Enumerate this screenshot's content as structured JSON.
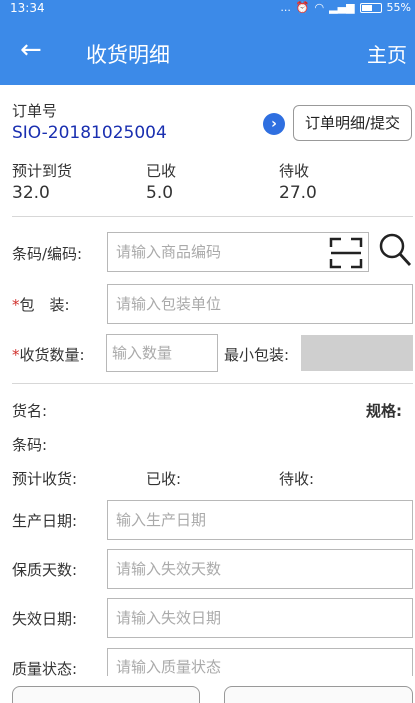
{
  "status": {
    "time": "13:34",
    "dots": "...",
    "battery": "55%"
  },
  "appbar": {
    "back": "←",
    "title": "收货明细",
    "home": "主页"
  },
  "order": {
    "label": "订单号",
    "number": "SIO-20181025004",
    "detail_button": "订单明细/提交"
  },
  "summary": {
    "expected_label": "预计到货",
    "expected_value": "32.0",
    "received_label": "已收",
    "received_value": "5.0",
    "pending_label": "待收",
    "pending_value": "27.0"
  },
  "form": {
    "barcode_label": "条码/编码:",
    "barcode_placeholder": "请输入商品编码",
    "package_star": "*",
    "package_label": "包　装:",
    "package_placeholder": "请输入包装单位",
    "qty_star": "*",
    "qty_label": "收货数量:",
    "qty_placeholder": "输入数量",
    "min_pack_label": "最小包装:"
  },
  "goods": {
    "name_label": "货名:",
    "spec_label": "规格:",
    "barcode_label": "条码:",
    "expected_label": "预计收货:",
    "received_label": "已收:",
    "pending_label": "待收:"
  },
  "dates": {
    "production_label": "生产日期:",
    "production_placeholder": "输入生产日期",
    "shelf_label": "保质天数:",
    "shelf_placeholder": "请输入失效天数",
    "expiry_label": "失效日期:",
    "expiry_placeholder": "请输入失效日期",
    "quality_label": "质量状态:",
    "quality_placeholder": "请输入质量状态"
  },
  "colors": {
    "primary": "#3c8ae8",
    "order_number": "#1a2fb0",
    "required": "#d0312d"
  }
}
